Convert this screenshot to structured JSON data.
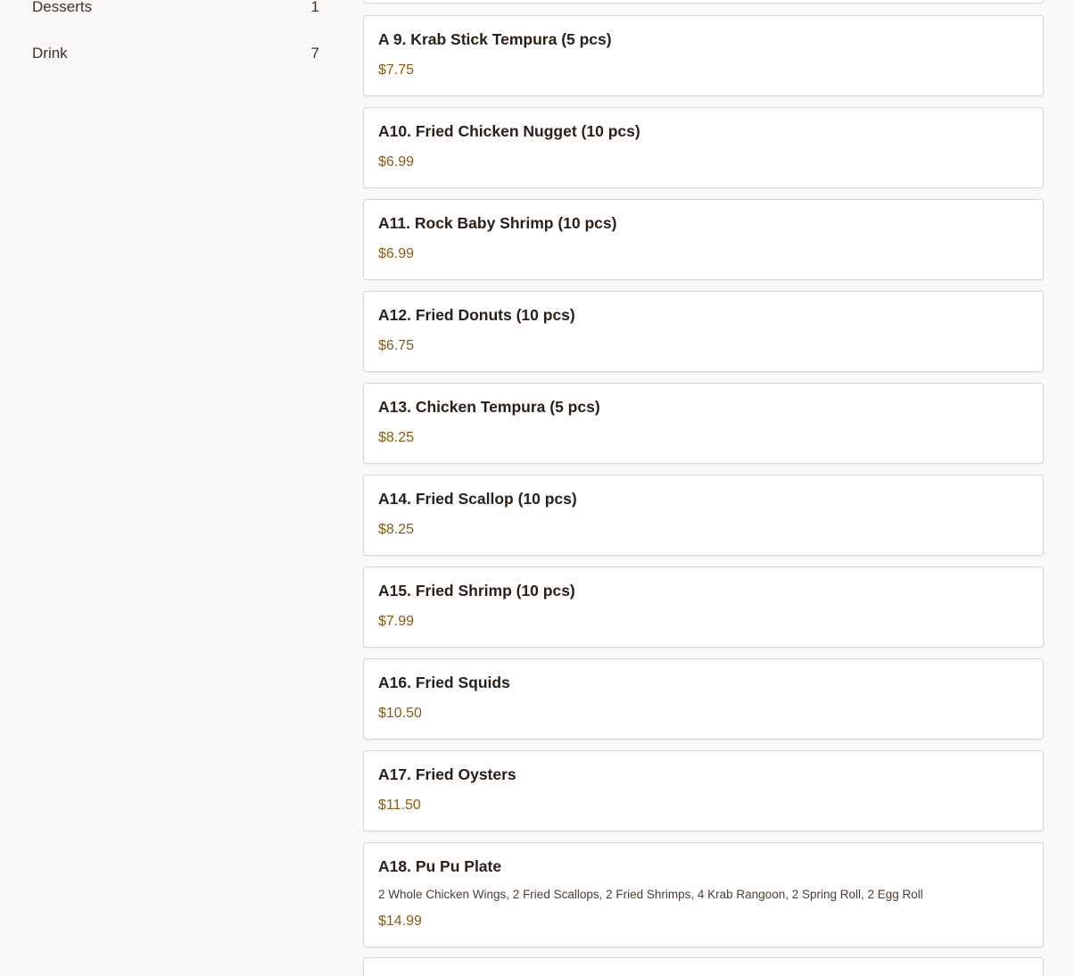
{
  "sidebar": {
    "categories": [
      {
        "label": "Desserts",
        "count": "1"
      },
      {
        "label": "Drink",
        "count": "7"
      }
    ]
  },
  "menu": {
    "items": [
      {
        "name": "A 9. Krab Stick Tempura (5 pcs)",
        "price": "$7.75"
      },
      {
        "name": "A10. Fried Chicken Nugget (10 pcs)",
        "price": "$6.99"
      },
      {
        "name": "A11. Rock Baby Shrimp (10 pcs)",
        "price": "$6.99"
      },
      {
        "name": "A12. Fried Donuts (10 pcs)",
        "price": "$6.75"
      },
      {
        "name": "A13. Chicken Tempura (5 pcs)",
        "price": "$8.25"
      },
      {
        "name": "A14. Fried Scallop (10 pcs)",
        "price": "$8.25"
      },
      {
        "name": "A15. Fried Shrimp (10 pcs)",
        "price": "$7.99"
      },
      {
        "name": "A16. Fried Squids",
        "price": "$10.50"
      },
      {
        "name": "A17. Fried Oysters",
        "price": "$11.50"
      },
      {
        "name": "A18. Pu Pu Plate",
        "description": "2 Whole Chicken Wings, 2 Fried Scallops, 2 Fried Shrimps, 4 Krab Rangoon, 2 Spring Roll, 2 Egg Roll",
        "price": "$14.99"
      }
    ]
  },
  "colors": {
    "background": "#faf9f7",
    "card": "#ffffff",
    "card_border": "#d9d6d2",
    "price": "#8a5a12",
    "title": "#2b2018"
  }
}
